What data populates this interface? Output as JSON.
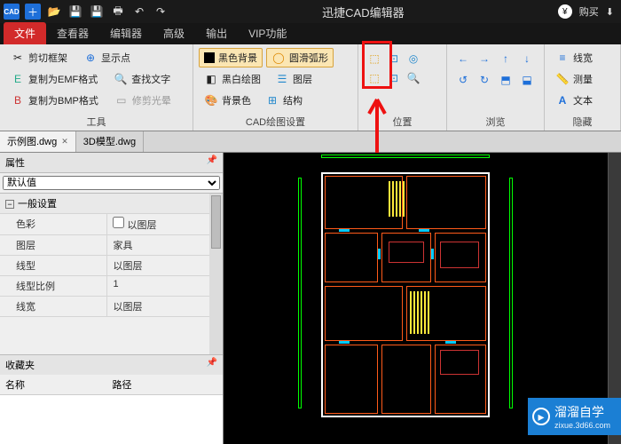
{
  "titlebar": {
    "app_badge": "CAD",
    "title": "迅捷CAD编辑器",
    "buy": "购买"
  },
  "ribbon_tabs": [
    "文件",
    "查看器",
    "编辑器",
    "高级",
    "输出",
    "VIP功能"
  ],
  "ribbon": {
    "group1_label": "工具",
    "btn_crop": "剪切框架",
    "btn_showpt": "显示点",
    "btn_emf": "复制为EMF格式",
    "btn_findtxt": "查找文字",
    "btn_bmp": "复制为BMP格式",
    "btn_trimlight": "修剪光晕",
    "group2_label": "CAD绘图设置",
    "btn_blackbg": "黑色背景",
    "btn_smootharc": "圆滑弧形",
    "btn_bwdraw": "黑白绘图",
    "btn_layer": "图层",
    "btn_bgcolor": "背景色",
    "btn_struct": "结构",
    "group3_label": "位置",
    "group4_label": "浏览",
    "group5_label": "隐藏",
    "btn_linew": "线宽",
    "btn_measure": "测量",
    "btn_text": "文本"
  },
  "doc_tabs": {
    "tab1": "示例图.dwg",
    "tab2": "3D模型.dwg"
  },
  "panel": {
    "title": "属性",
    "default_combo": "默认值",
    "section_general": "一般设置",
    "rows": [
      {
        "k": "色彩",
        "v": "以图层",
        "cb": true
      },
      {
        "k": "图层",
        "v": "家具"
      },
      {
        "k": "线型",
        "v": "以图层"
      },
      {
        "k": "线型比例",
        "v": "1"
      },
      {
        "k": "线宽",
        "v": "以图层"
      }
    ],
    "fav_title": "收藏夹",
    "fav_col1": "名称",
    "fav_col2": "路径"
  },
  "watermark": {
    "main": "溜溜自学",
    "sub": "zixue.3d66.com"
  }
}
